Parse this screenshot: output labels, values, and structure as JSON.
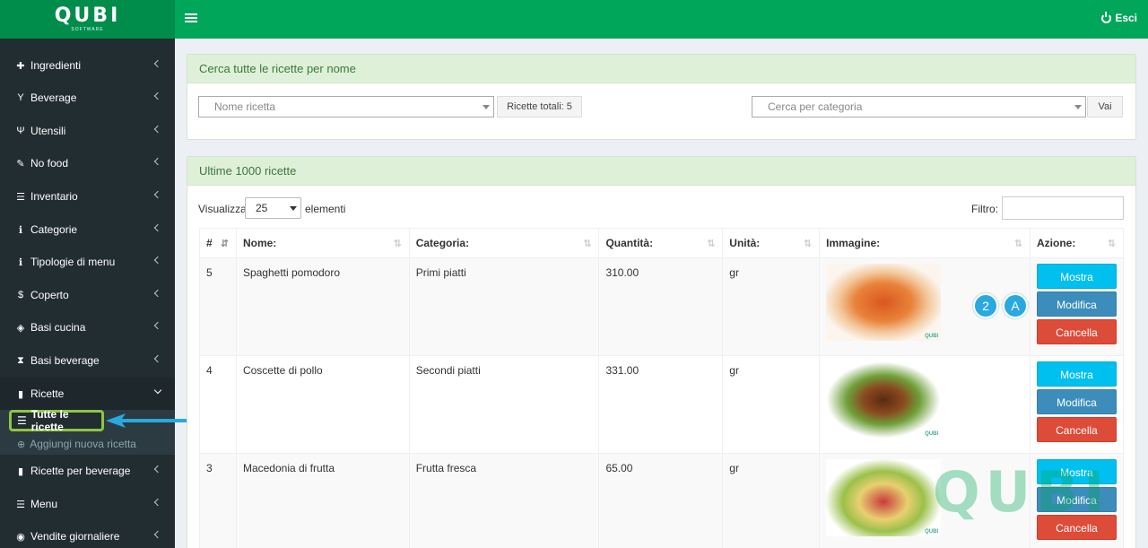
{
  "header": {
    "logo_text": "QUBI",
    "logo_sub": "SOFTWARE",
    "logout_label": "Esci"
  },
  "sidebar": {
    "items": [
      {
        "label": "Ingredienti",
        "icon": "puzzle-icon",
        "glyph": "✚"
      },
      {
        "label": "Beverage",
        "icon": "glass-icon",
        "glyph": "Y"
      },
      {
        "label": "Utensili",
        "icon": "cutlery-icon",
        "glyph": "Ψ"
      },
      {
        "label": "No food",
        "icon": "wrench-icon",
        "glyph": "✎"
      },
      {
        "label": "Inventario",
        "icon": "list-icon",
        "glyph": "☰"
      },
      {
        "label": "Categorie",
        "icon": "info-icon",
        "glyph": "ℹ"
      },
      {
        "label": "Tipologie di menu",
        "icon": "info-icon",
        "glyph": "ℹ"
      },
      {
        "label": "Coperto",
        "icon": "dollar-icon",
        "glyph": "$"
      },
      {
        "label": "Basi cucina",
        "icon": "cube-icon",
        "glyph": "◈"
      },
      {
        "label": "Basi beverage",
        "icon": "hourglass-icon",
        "glyph": "⧗"
      },
      {
        "label": "Ricette",
        "icon": "file-icon",
        "glyph": "▮"
      },
      {
        "label": "Ricette per beverage",
        "icon": "file-icon",
        "glyph": "▮"
      },
      {
        "label": "Menu",
        "icon": "list-icon",
        "glyph": "☰"
      },
      {
        "label": "Vendite giornaliere",
        "icon": "arrow-circle-icon",
        "glyph": "◉"
      }
    ],
    "submenu": {
      "all_recipes": "Tutte le ricette",
      "add_recipe": "Aggiungi nuova ricetta"
    }
  },
  "search_box": {
    "title": "Cerca tutte le ricette per nome",
    "name_placeholder": "Nome ricetta",
    "total_label": "Ricette totali: 5",
    "category_placeholder": "Cerca per categoria",
    "go_label": "Vai"
  },
  "recipes_box": {
    "title": "Ultime 1000 ricette",
    "show_label": "Visualizza",
    "page_size": "25",
    "elements_label": "elementi",
    "filter_label": "Filtro:",
    "columns": [
      "#",
      "Nome:",
      "Categoria:",
      "Quantità:",
      "Unità:",
      "Immagine:",
      "Azione:"
    ],
    "rows": [
      {
        "id": "5",
        "name": "Spaghetti pomodoro",
        "category": "Primi piatti",
        "qty": "310.00",
        "unit": "gr"
      },
      {
        "id": "4",
        "name": "Coscette di pollo",
        "category": "Secondi piatti",
        "qty": "331.00",
        "unit": "gr"
      },
      {
        "id": "3",
        "name": "Macedonia di frutta",
        "category": "Frutta fresca",
        "qty": "65.00",
        "unit": "gr"
      }
    ],
    "actions": {
      "show": "Mostra",
      "edit": "Modifica",
      "delete": "Cancella"
    }
  },
  "annotations": {
    "step": "2",
    "letter": "A"
  },
  "watermark": "QUBI",
  "thumb_mark": "QUBI",
  "colors": {
    "topbar": "#00a65a",
    "sidebar": "#222d32",
    "highlight": "#8dc63f",
    "arrow": "#29a9e0"
  }
}
